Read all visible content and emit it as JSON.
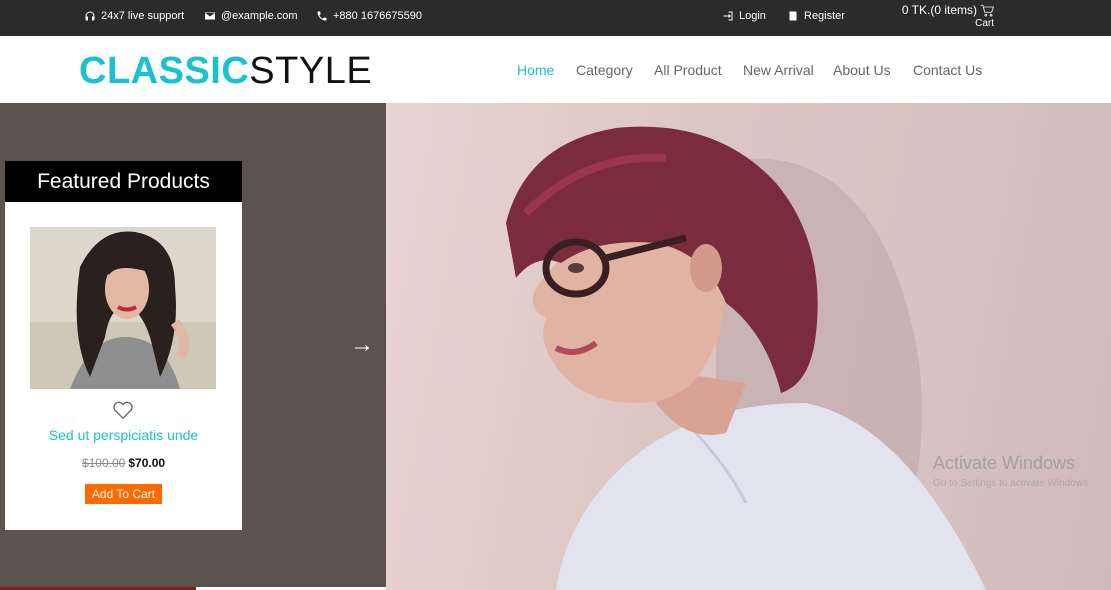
{
  "topbar": {
    "support": "24x7 live support",
    "email": "@example.com",
    "phone": "+880 1676675590",
    "login": "Login",
    "register": "Register",
    "cart_total": "0 TK.(0 items)",
    "cart_label": "Cart"
  },
  "header": {
    "logo_part1": "CLASSIC",
    "logo_part2": "STYLE",
    "nav": [
      "Home",
      "Category",
      "All Product",
      "New Arrival",
      "About Us",
      "Contact Us"
    ],
    "active_nav": "Home"
  },
  "featured": {
    "title": "Featured Products",
    "product": {
      "name": "Sed ut perspiciatis unde",
      "old_price": "$100.00",
      "new_price": "$70.00",
      "button": "Add To Cart"
    }
  },
  "hero": {
    "arrow": "→"
  },
  "watermark": {
    "title": "Activate Windows",
    "subtitle": "Go to Settings to activate Windows."
  },
  "colors": {
    "accent": "#19c2cc",
    "topbar": "#2b2b2b",
    "button": "#ff6a00"
  }
}
